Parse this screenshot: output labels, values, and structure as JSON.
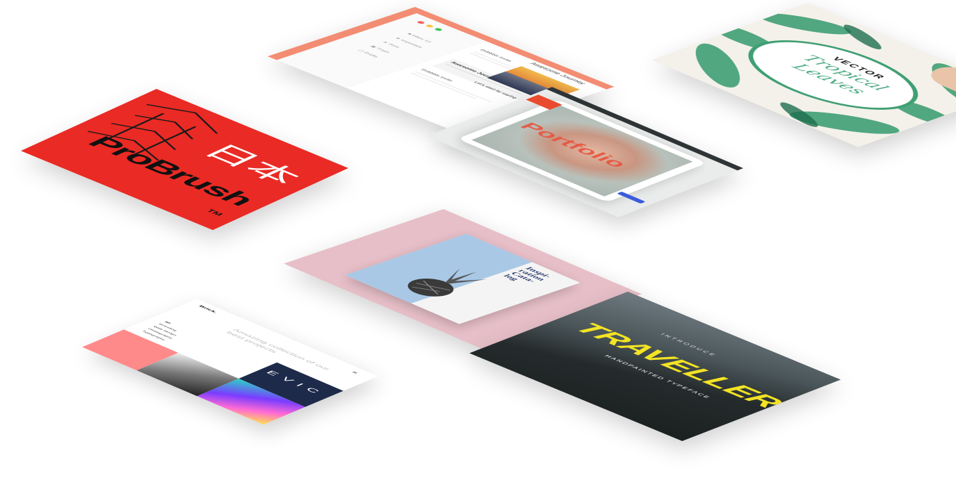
{
  "colors": {
    "probrush_red": "#ea2a24",
    "mail_salmon": "#f28d73",
    "pink_bg": "#e7bfc8",
    "traveller_yellow": "#f3e324",
    "tropical_green": "#3f9f73"
  },
  "probrush": {
    "kanji": "日本",
    "title": "ProBrush",
    "tm": "TM"
  },
  "mail": {
    "window_dots": [
      "#f35d5d",
      "#f7c244",
      "#3dc154"
    ],
    "sidebar": [
      {
        "label": "Inbox",
        "count": "12",
        "icon": "inbox-icon"
      },
      {
        "label": "Important",
        "icon": "star-icon"
      },
      {
        "label": "Sent",
        "icon": "send-icon"
      },
      {
        "label": "Trash",
        "icon": "trash-icon"
      },
      {
        "label": "Drafts",
        "icon": "draft-icon"
      }
    ],
    "messages": [
      {
        "from": "Dribbble Invite",
        "subject": ""
      },
      {
        "from": "Awesome Journey",
        "subject": "Awesome Journey"
      },
      {
        "from": "Dribbble Invite",
        "subject": ""
      }
    ],
    "detail": {
      "title": "Awesome Journey",
      "footer": "Let's start by saying"
    }
  },
  "portfolio": {
    "title": "Portfolio"
  },
  "tropical": {
    "vector": "VECTOR",
    "line1": "Tropical",
    "line2": "Leaves"
  },
  "brick": {
    "logo": "Brick.",
    "tagline": "Amazing collection of our best projects",
    "nav": [
      "3D",
      "Branding",
      "Web design",
      "Photography",
      "Typography"
    ],
    "tiles_text": "EVIC"
  },
  "catalog": {
    "title_lines": [
      "Inspi-",
      "ration",
      "Cata-",
      "log"
    ]
  },
  "traveller": {
    "introduce": "INTRODUCE",
    "title": "TRAVELLER",
    "subtitle": "HANDPAINTED TYPEFACE"
  }
}
